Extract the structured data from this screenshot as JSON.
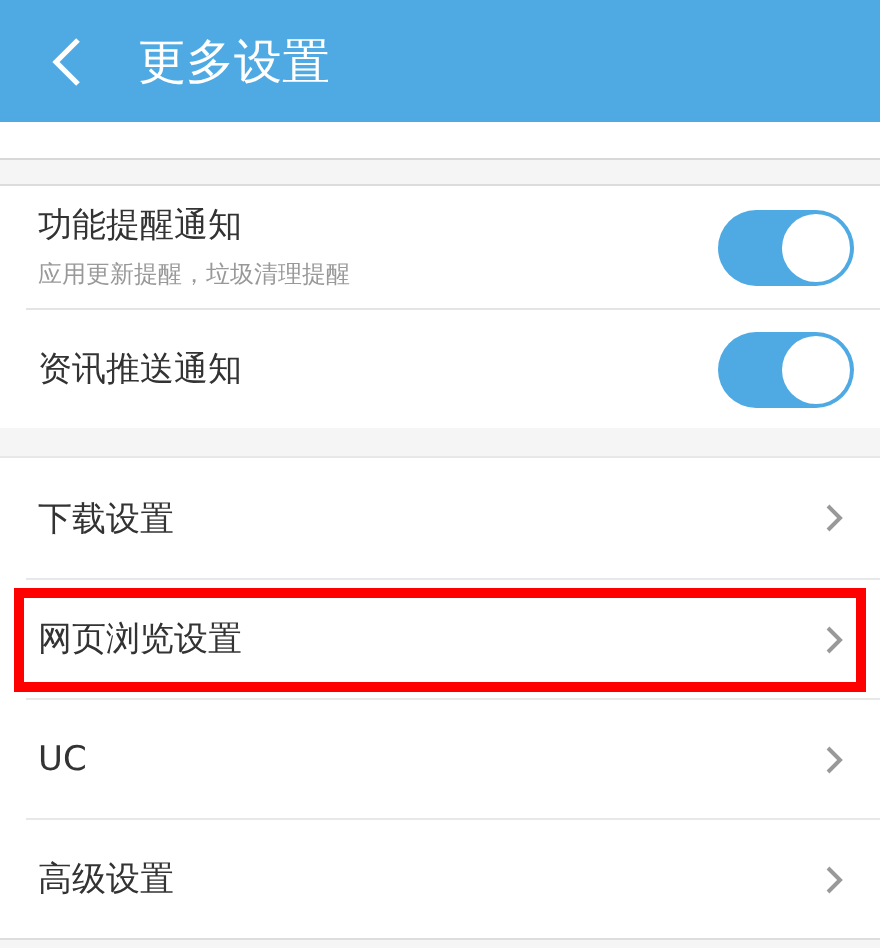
{
  "header": {
    "title": "更多设置"
  },
  "notifications": [
    {
      "label": "功能提醒通知",
      "description": "应用更新提醒，垃圾清理提醒",
      "on": true
    },
    {
      "label": "资讯推送通知",
      "on": true
    }
  ],
  "settings": [
    {
      "label": "下载设置",
      "highlighted": false
    },
    {
      "label": "网页浏览设置",
      "highlighted": true
    },
    {
      "label": "UC",
      "highlighted": false
    },
    {
      "label": "高级设置",
      "highlighted": false
    }
  ]
}
